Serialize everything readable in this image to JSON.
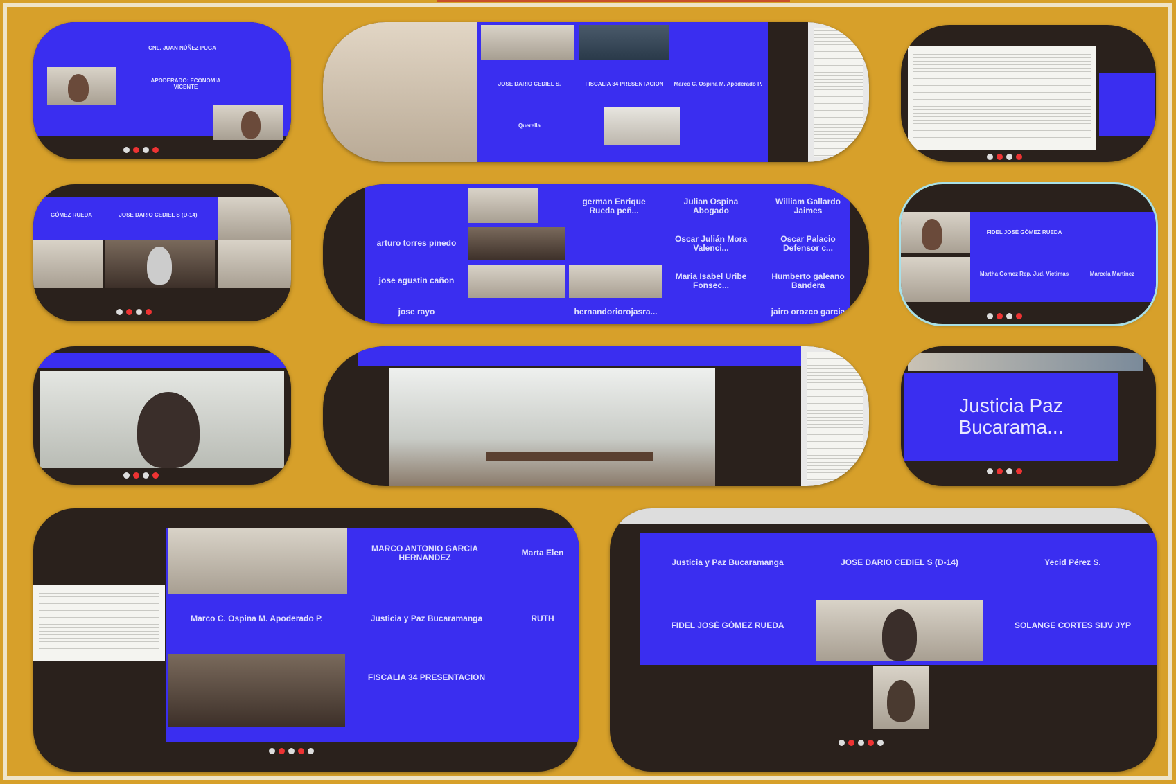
{
  "panel_top_left": {
    "tiles": [
      "",
      "CNL. JUAN NÚÑEZ PUGA",
      "",
      "APODERADO: ECONOMIA VICENTE",
      "",
      "",
      ""
    ]
  },
  "panel_top_middle": {
    "tiles": [
      "",
      "JOSE DARIO CEDIEL S.",
      "FISCALIA 34 PRESENTACION",
      "Marco C. Ospina M. Apoderado P.",
      "Querella"
    ]
  },
  "panel_row2_middle": {
    "tiles": [
      "german Enrique Rueda peñ...",
      "Julian Ospina Abogado",
      "William Gallardo Jaimes",
      "arturo torres pinedo",
      "Oscar Julián Mora Valenci...",
      "Oscar Palacio Defensor c...",
      "jose agustin cañon",
      "Maria Isabel Uribe Fonsec...",
      "Humberto galeano Bandera",
      "jose rayo",
      "hernandoriorojasra...",
      "jairo orozco garcia"
    ]
  },
  "panel_row2_right": {
    "tiles": [
      "FIDEL JOSÉ GÓMEZ RUEDA",
      "Martha Gomez Rep. Jud. Victimas",
      "Marcela Martinez"
    ]
  },
  "panel_row3_right": {
    "title": "Justicia Paz Bucarama..."
  },
  "panel_bottom_left": {
    "tiles": [
      "MARCO ANTONIO GARCIA HERNANDEZ",
      "Marta Elen",
      "Marco C. Ospina M. Apoderado P.",
      "Justicia y Paz Bucaramanga",
      "RUTH",
      "FISCALIA 34 PRESENTACION"
    ]
  },
  "panel_bottom_right": {
    "tiles": [
      "Justicia y Paz Bucaramanga",
      "JOSE DARIO CEDIEL S (D-14)",
      "Yecid Pérez S.",
      "FIDEL JOSÉ GÓMEZ RUEDA",
      "SOLANGE CORTES SIJV JYP"
    ]
  },
  "panel_row2_left": {
    "tiles": [
      "GÓMEZ RUEDA",
      "JOSE DARIO CEDIEL S (D-14)"
    ]
  },
  "icons": [
    "mic-icon",
    "camera-icon",
    "share-icon",
    "end-call-icon",
    "more-icon"
  ],
  "colors": {
    "background": "#d7a02a",
    "tile_blue": "#3a2ef0",
    "frame": "#efe4c8"
  }
}
